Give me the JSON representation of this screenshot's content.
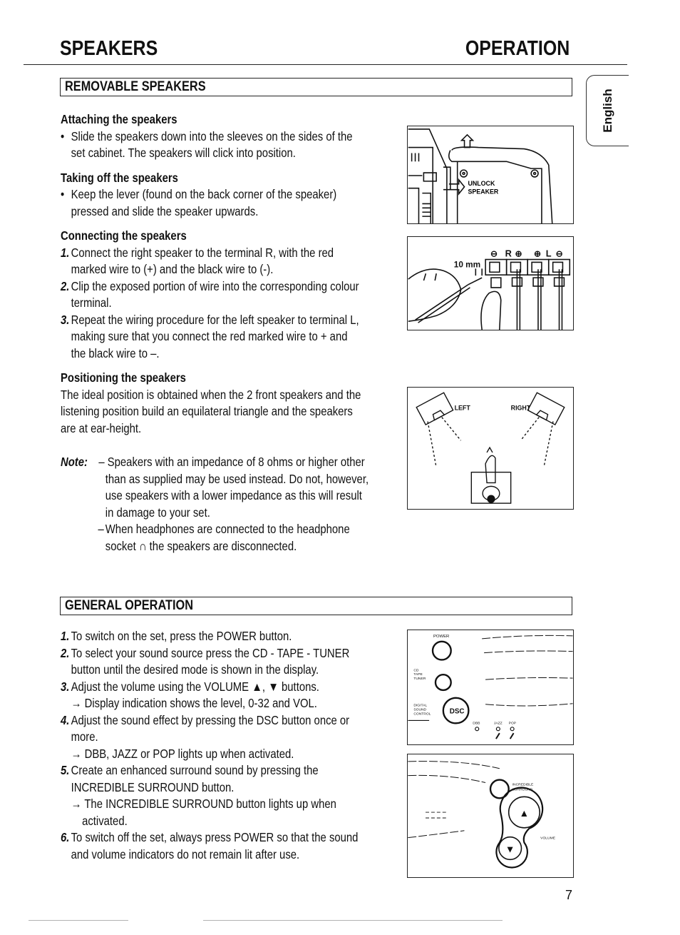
{
  "header": {
    "left_title": "SPEAKERS",
    "right_title": "OPERATION"
  },
  "language_tab": "English",
  "page_number": "7",
  "removable_speakers": {
    "section_title": "REMOVABLE SPEAKERS",
    "attaching": {
      "heading": "Attaching the speakers",
      "bullet": "•",
      "lines": [
        "Slide the speakers down into the sleeves on the sides of the",
        "set cabinet. The speakers will click into position."
      ]
    },
    "taking_off": {
      "heading": "Taking off the speakers",
      "bullet": "•",
      "lines": [
        "Keep the lever (found on the back corner of the speaker)",
        "pressed and slide the speaker upwards."
      ]
    },
    "connecting": {
      "heading": "Connecting the speakers",
      "steps": [
        {
          "num": "1.",
          "lines": [
            "Connect the right speaker to the terminal R, with the red",
            "marked wire to (+) and the black wire to (-)."
          ]
        },
        {
          "num": "2.",
          "lines": [
            "Clip the exposed portion of wire into the corresponding colour",
            "terminal."
          ]
        },
        {
          "num": "3.",
          "lines": [
            "Repeat the wiring procedure for the left speaker to terminal L,",
            "making sure that you connect the red marked wire to + and",
            "the black wire to –."
          ]
        }
      ]
    },
    "positioning": {
      "heading": "Positioning the speakers",
      "lines": [
        "The ideal position is obtained when the 2 front speakers and the",
        "listening position build an equilateral triangle and the speakers",
        "are at ear-height."
      ]
    },
    "note": {
      "label": "Note:",
      "dash": "–",
      "items": [
        [
          "Speakers with an impedance of 8 ohms or higher other",
          "than as supplied may be used instead. Do not, however,",
          "use speakers with a lower impedance as this will result",
          "in damage to your set."
        ],
        [
          "When headphones are connected to the headphone",
          "socket ∩ the speakers are disconnected."
        ]
      ]
    }
  },
  "general_operation": {
    "section_title": "GENERAL OPERATION",
    "arrow": "→",
    "steps": [
      {
        "num": "1.",
        "lines": [
          "To switch on the set, press the POWER button."
        ]
      },
      {
        "num": "2.",
        "lines": [
          "To select your sound source press the CD - TAPE - TUNER",
          "button until the desired mode is shown in the display."
        ]
      },
      {
        "num": "3.",
        "lines": [
          "Adjust the volume using the VOLUME ▲, ▼ buttons."
        ],
        "result": [
          "Display indication shows the level, 0-32 and VOL."
        ]
      },
      {
        "num": "4.",
        "lines": [
          "Adjust the sound effect by pressing the DSC button once or",
          "more."
        ],
        "result": [
          "DBB, JAZZ or POP lights up when activated."
        ]
      },
      {
        "num": "5.",
        "lines": [
          "Create an enhanced surround sound by pressing the",
          "INCREDIBLE SURROUND button."
        ],
        "result": [
          "The INCREDIBLE SURROUND button lights up when",
          "activated."
        ]
      },
      {
        "num": "6.",
        "lines": [
          "To switch off the set, always press POWER so that the sound",
          "and volume indicators do not remain lit after use."
        ]
      }
    ]
  },
  "illustrations": {
    "unlock": {
      "label_line1": "UNLOCK",
      "label_line2": "SPEAKER"
    },
    "terminals": {
      "measure": "10 mm",
      "minus": "⊖",
      "plus": "⊕",
      "r": "R",
      "l": "L"
    },
    "positioning": {
      "left": "LEFT",
      "right": "RIGHT"
    },
    "front_panel": {
      "power": "POWER",
      "source": [
        "CD",
        "TAPE",
        "TUNER"
      ],
      "dsc": "DSC",
      "dsc_label": [
        "DIGITAL",
        "SOUND",
        "CONTROL"
      ],
      "modes": [
        "DBB",
        "JAZZ",
        "POP"
      ]
    },
    "surround_panel": {
      "surround": [
        "INCREDIBLE",
        "SURROUND"
      ],
      "volume": "VOLUME",
      "up": "▲",
      "down": "▼"
    }
  }
}
